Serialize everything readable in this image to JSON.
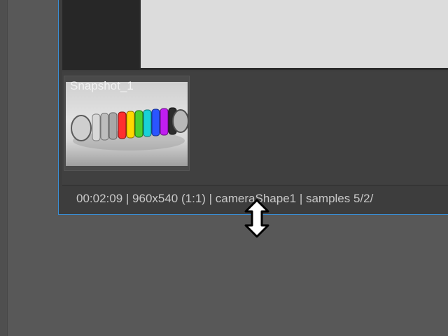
{
  "snapshot": {
    "label": "Snapshot_1"
  },
  "status": {
    "text": "00:02:09 | 960x540 (1:1) | cameraShape1  | samples 5/2/"
  },
  "icons": {
    "cursor": "vertical-resize-cursor"
  },
  "colors": {
    "window_border": "#3a8fd6",
    "background": "#585858",
    "panel": "#3d3d3d",
    "render_image": "#dcdcdc"
  }
}
